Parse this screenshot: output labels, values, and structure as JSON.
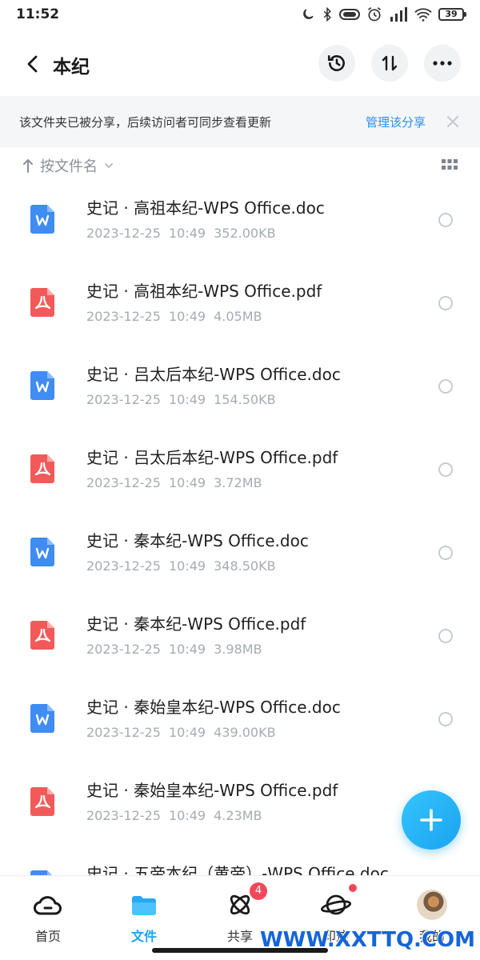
{
  "status_bar": {
    "time": "11:52",
    "battery": "39",
    "icons": [
      "moon-icon",
      "bluetooth-icon",
      "vibrate-icon",
      "alarm-icon",
      "signal-icon",
      "wifi-icon",
      "battery-icon"
    ]
  },
  "header": {
    "title": "本纪",
    "actions": [
      "history-icon",
      "sort-order-icon",
      "more-icon"
    ]
  },
  "share_banner": {
    "text": "该文件夹已被分享，后续访问者可同步查看更新",
    "manage_label": "管理该分享"
  },
  "sort": {
    "label": "按文件名"
  },
  "files": [
    {
      "name": "史记 · 高祖本纪-WPS Office.doc",
      "date": "2023-12-25",
      "time": "10:49",
      "size": "352.00KB",
      "type": "doc"
    },
    {
      "name": "史记 · 高祖本纪-WPS Office.pdf",
      "date": "2023-12-25",
      "time": "10:49",
      "size": "4.05MB",
      "type": "pdf"
    },
    {
      "name": "史记 · 吕太后本纪-WPS Office.doc",
      "date": "2023-12-25",
      "time": "10:49",
      "size": "154.50KB",
      "type": "doc"
    },
    {
      "name": "史记 · 吕太后本纪-WPS Office.pdf",
      "date": "2023-12-25",
      "time": "10:49",
      "size": "3.72MB",
      "type": "pdf"
    },
    {
      "name": "史记 · 秦本纪-WPS Office.doc",
      "date": "2023-12-25",
      "time": "10:49",
      "size": "348.50KB",
      "type": "doc"
    },
    {
      "name": "史记 · 秦本纪-WPS Office.pdf",
      "date": "2023-12-25",
      "time": "10:49",
      "size": "3.98MB",
      "type": "pdf"
    },
    {
      "name": "史记 · 秦始皇本纪-WPS Office.doc",
      "date": "2023-12-25",
      "time": "10:49",
      "size": "439.00KB",
      "type": "doc"
    },
    {
      "name": "史记 · 秦始皇本纪-WPS Office.pdf",
      "date": "2023-12-25",
      "time": "10:49",
      "size": "4.23MB",
      "type": "pdf"
    },
    {
      "name": "史记 · 五帝本纪（黄帝）-WPS Office.doc",
      "date": "",
      "time": "",
      "size": "",
      "type": "doc"
    }
  ],
  "bottom_nav": [
    {
      "label": "首页",
      "icon": "cloud-icon",
      "active": false
    },
    {
      "label": "文件",
      "icon": "folder-icon",
      "active": true
    },
    {
      "label": "共享",
      "icon": "atom-icon",
      "active": false,
      "badge": "4"
    },
    {
      "label": "印迹",
      "icon": "planet-icon",
      "active": false
    },
    {
      "label": "我的",
      "icon": "avatar",
      "active": false
    }
  ],
  "watermark": "WWW.XXTTQ.COM",
  "colors": {
    "accent": "#1aa4ee",
    "link": "#2e8ee6",
    "doc_icon": "#3f8cf3",
    "pdf_icon": "#f25a5a",
    "badge": "#f5475a"
  }
}
